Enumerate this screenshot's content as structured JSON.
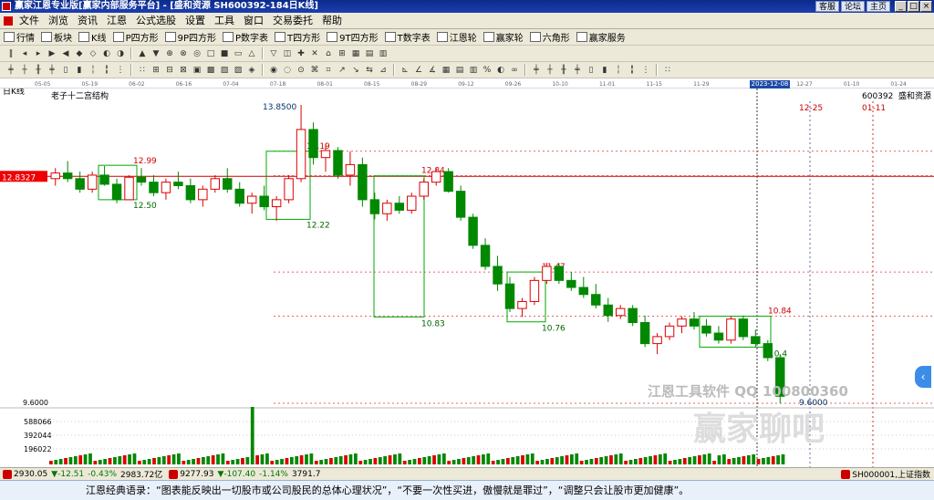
{
  "window": {
    "title": "赢家江恩专业版[赢家内部服务平台] - [盛和资源  SH600392-184日K线]",
    "right_buttons": [
      "客服",
      "论坛",
      "主页"
    ]
  },
  "menu": [
    "文件",
    "浏览",
    "资讯",
    "江恩",
    "公式选股",
    "设置",
    "工具",
    "窗口",
    "交易委托",
    "帮助"
  ],
  "toolbar_main": [
    "行情",
    "板块",
    "K线",
    "P四方形",
    "9P四方形",
    "P数字表",
    "T四方形",
    "9T四方形",
    "T数字表",
    "江恩轮",
    "赢家轮",
    "六角形",
    "赢家服务"
  ],
  "date_axis": {
    "labels": [
      "05-05",
      "05-19",
      "06-02",
      "06-16",
      "07-04",
      "07-18",
      "08-01",
      "08-15",
      "08-29",
      "09-12",
      "09-26",
      "10-10",
      "11-01",
      "11-15",
      "11-29",
      "2023-12-08",
      "12-27",
      "01-10",
      "01-24"
    ],
    "highlighted": "2023-12-08"
  },
  "chart": {
    "period": "日K线",
    "structure_label": "老子十二宫结构",
    "code": "600392",
    "name": "盛和资源",
    "current_price_tag": "12.8327",
    "marker_dates": [
      "12-25",
      "01-11"
    ],
    "price_labels": [
      "13.8500",
      "13.19",
      "12.99",
      "12.84",
      "12.50",
      "12.22",
      "11.47",
      "10.83",
      "10.84",
      "10.76",
      "10.4",
      "9.6000"
    ],
    "price_axis_low": "9.6000",
    "volume_axis_labels": [
      "588066",
      "392044",
      "196022"
    ],
    "watermarks": [
      "江恩工具软件  QQ 100800360",
      "赢家聊吧"
    ]
  },
  "chart_data": {
    "type": "candlestick",
    "title": "老子十二宫结构",
    "ohlc": [
      [
        12.8,
        12.95,
        12.7,
        12.88
      ],
      [
        12.88,
        13.05,
        12.75,
        12.8
      ],
      [
        12.8,
        12.9,
        12.6,
        12.65
      ],
      [
        12.65,
        12.9,
        12.6,
        12.85
      ],
      [
        12.85,
        12.98,
        12.7,
        12.72
      ],
      [
        12.72,
        12.8,
        12.45,
        12.5
      ],
      [
        12.5,
        12.85,
        12.5,
        12.82
      ],
      [
        12.82,
        12.95,
        12.7,
        12.75
      ],
      [
        12.75,
        12.85,
        12.55,
        12.6
      ],
      [
        12.6,
        12.8,
        12.5,
        12.75
      ],
      [
        12.75,
        12.9,
        12.65,
        12.7
      ],
      [
        12.7,
        12.8,
        12.45,
        12.5
      ],
      [
        12.5,
        12.7,
        12.4,
        12.65
      ],
      [
        12.65,
        12.85,
        12.6,
        12.8
      ],
      [
        12.8,
        12.95,
        12.6,
        12.65
      ],
      [
        12.65,
        12.75,
        12.4,
        12.45
      ],
      [
        12.45,
        12.6,
        12.3,
        12.55
      ],
      [
        12.55,
        12.7,
        12.35,
        12.4
      ],
      [
        12.4,
        12.55,
        12.2,
        12.5
      ],
      [
        12.5,
        12.85,
        12.45,
        12.8
      ],
      [
        12.8,
        13.85,
        12.75,
        13.5
      ],
      [
        13.5,
        13.6,
        13.0,
        13.1
      ],
      [
        13.1,
        13.3,
        12.9,
        13.2
      ],
      [
        13.2,
        13.25,
        12.8,
        12.85
      ],
      [
        12.85,
        13.19,
        12.7,
        13.0
      ],
      [
        13.0,
        13.1,
        12.4,
        12.5
      ],
      [
        12.5,
        12.6,
        12.22,
        12.3
      ],
      [
        12.3,
        12.5,
        12.2,
        12.45
      ],
      [
        12.45,
        12.55,
        12.3,
        12.35
      ],
      [
        12.35,
        12.6,
        12.3,
        12.55
      ],
      [
        12.55,
        12.8,
        12.5,
        12.75
      ],
      [
        12.75,
        12.95,
        12.7,
        12.9
      ],
      [
        12.9,
        12.95,
        12.6,
        12.62
      ],
      [
        12.62,
        12.7,
        12.2,
        12.25
      ],
      [
        12.25,
        12.3,
        11.8,
        11.85
      ],
      [
        11.85,
        11.95,
        11.5,
        11.55
      ],
      [
        11.55,
        11.7,
        11.2,
        11.3
      ],
      [
        11.3,
        11.4,
        10.9,
        10.95
      ],
      [
        10.95,
        11.1,
        10.83,
        11.05
      ],
      [
        11.05,
        11.4,
        11.0,
        11.35
      ],
      [
        11.35,
        11.6,
        11.3,
        11.55
      ],
      [
        11.55,
        11.6,
        11.3,
        11.35
      ],
      [
        11.35,
        11.47,
        11.2,
        11.25
      ],
      [
        11.25,
        11.4,
        11.1,
        11.15
      ],
      [
        11.15,
        11.3,
        10.95,
        11.0
      ],
      [
        11.0,
        11.1,
        10.76,
        10.85
      ],
      [
        10.85,
        11.0,
        10.8,
        10.95
      ],
      [
        10.95,
        11.0,
        10.7,
        10.75
      ],
      [
        10.75,
        10.85,
        10.4,
        10.45
      ],
      [
        10.45,
        10.6,
        10.3,
        10.55
      ],
      [
        10.55,
        10.75,
        10.5,
        10.7
      ],
      [
        10.7,
        10.84,
        10.6,
        10.8
      ],
      [
        10.8,
        10.9,
        10.65,
        10.7
      ],
      [
        10.7,
        10.8,
        10.55,
        10.6
      ],
      [
        10.6,
        10.7,
        10.45,
        10.5
      ],
      [
        10.5,
        10.84,
        10.45,
        10.8
      ],
      [
        10.8,
        10.85,
        10.5,
        10.55
      ],
      [
        10.55,
        10.65,
        10.4,
        10.45
      ],
      [
        10.45,
        10.5,
        10.2,
        10.25
      ],
      [
        10.25,
        10.3,
        9.6,
        9.7
      ]
    ],
    "ylim": [
      9.6,
      13.85
    ]
  },
  "status": {
    "idx1": "2930.05",
    "idx1_chg": "▼-12.51",
    "idx1_pct": "-0.43%",
    "idx1_val": "2983.72亿",
    "idx2": "9277.93",
    "idx2_chg": "▼-107.40",
    "idx2_pct": "-1.14%",
    "idx2_val": "3791.7",
    "right_code": "SH000001,上证指数"
  },
  "quote": "江恩经典语录：“图表能反映出一切股市或公司股民的总体心理状况”，“不要一次性买进，傲慢就是罪过”，“调整只会让股市更加健康”。"
}
